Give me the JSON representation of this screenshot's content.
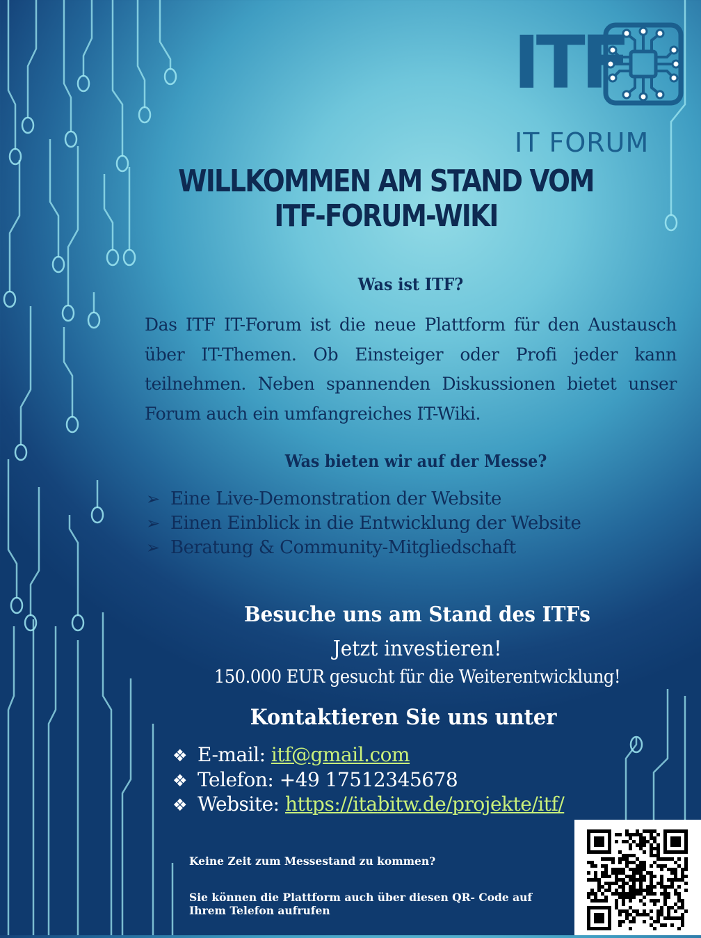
{
  "logo": {
    "mark": "ITF",
    "subtitle": "IT FORUM",
    "icon": "circuit-chip-icon",
    "color": "#1b5f8e"
  },
  "headline": {
    "line1": "WILLKOMMEN AM STAND VOM",
    "line2": "ITF-FORUM-WIKI"
  },
  "about": {
    "heading": "Was ist ITF?",
    "text": "Das ITF IT-Forum ist die neue Plattform für den Austausch über IT-Themen. Ob Einsteiger oder Profi jeder kann teilnehmen. Neben spannenden Diskussionen bietet unser Forum auch ein umfangreiches IT-Wiki."
  },
  "offer": {
    "heading": "Was bieten wir auf der Messe?",
    "bullet_icon": "arrow-right-icon",
    "items": [
      "Eine Live-Demonstration der Website",
      "Einen Einblick in die Entwicklung der Website",
      "Beratung & Community-Mitgliedschaft"
    ]
  },
  "visit": {
    "heading": "Besuche uns am Stand des ITFs",
    "invest": "Jetzt investieren!",
    "funding": "150.000 EUR gesucht für die Weiterentwicklung!"
  },
  "contact": {
    "heading": "Kontaktieren Sie uns unter",
    "bullet_icon": "diamond-bullet-icon",
    "email_label": "E-mail: ",
    "email": "itf@gmail.com",
    "phone_label": "Telefon: ",
    "phone": "+49 17512345678",
    "website_label": "Website: ",
    "website": "https://itabitw.de/projekte/itf/",
    "link_color": "#c9f07a"
  },
  "qr_note": {
    "line1": "Keine Zeit zum Messestand zu kommen?",
    "line2": "Sie können die Plattform auch über diesen QR- Code auf Ihrem Telefon aufrufen"
  },
  "colors": {
    "text_dark": "#0f2e5c",
    "text_light": "#ffffff",
    "background_center": "#93dbe6",
    "background_edge": "#0f3a6e",
    "circuit": "#9fe8f2"
  }
}
